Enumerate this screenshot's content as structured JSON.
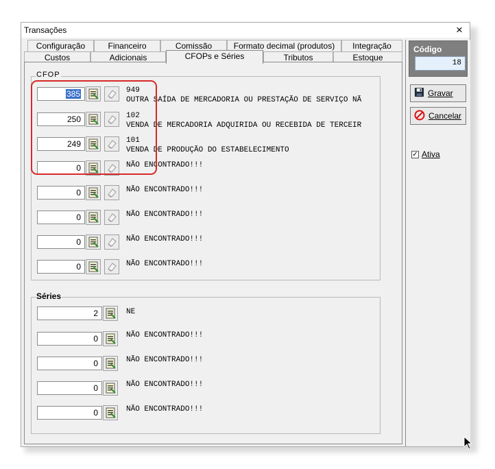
{
  "window": {
    "title": "Transações",
    "close_glyph": "×"
  },
  "tabs_row1": [
    "Configuração",
    "Financeiro",
    "Comissão",
    "Formato decimal (produtos)",
    "Integração"
  ],
  "tabs_row2": [
    "Custos",
    "Adicionais",
    "CFOPs e Séries",
    "Tributos",
    "Estoque"
  ],
  "active_tab": "CFOPs e Séries",
  "cfop_group": {
    "label": "CFOP",
    "rows": [
      {
        "value": "385",
        "selected": true,
        "line1": "949",
        "line2": "OUTRA SAÍDA DE MERCADORIA OU PRESTAÇÃO DE SERVIÇO NÃ"
      },
      {
        "value": "250",
        "line1": "102",
        "line2": "VENDA DE MERCADORIA ADQUIRIDA OU RECEBIDA DE TERCEIR"
      },
      {
        "value": "249",
        "line1": "101",
        "line2": "VENDA DE PRODUÇÃO DO ESTABELECIMENTO"
      },
      {
        "value": "0",
        "line1": "NÃO ENCONTRADO!!!",
        "line2": ""
      },
      {
        "value": "0",
        "line1": "NÃO ENCONTRADO!!!",
        "line2": ""
      },
      {
        "value": "0",
        "line1": "NÃO ENCONTRADO!!!",
        "line2": ""
      },
      {
        "value": "0",
        "line1": "NÃO ENCONTRADO!!!",
        "line2": ""
      },
      {
        "value": "0",
        "line1": "NÃO ENCONTRADO!!!",
        "line2": ""
      }
    ]
  },
  "series_group": {
    "label": "Séries",
    "rows": [
      {
        "value": "2",
        "text": "NE"
      },
      {
        "value": "0",
        "text": "NÃO ENCONTRADO!!!"
      },
      {
        "value": "0",
        "text": "NÃO ENCONTRADO!!!"
      },
      {
        "value": "0",
        "text": "NÃO ENCONTRADO!!!"
      },
      {
        "value": "0",
        "text": "NÃO ENCONTRADO!!!"
      }
    ]
  },
  "side": {
    "codigo_label": "Código",
    "codigo_value": "18",
    "gravar_label": "Gravar",
    "cancelar_label": "Cancelar",
    "ativa_label": "Ativa",
    "ativa_checked": true
  },
  "colors": {
    "highlight": "#d62828",
    "selection": "#3870c8",
    "codigo_bg": "#7f7f7f"
  }
}
